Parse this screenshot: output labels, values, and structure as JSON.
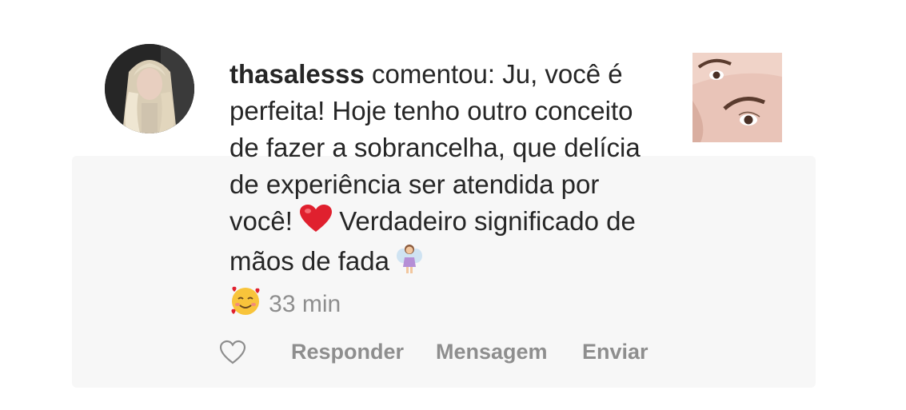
{
  "comment": {
    "username": "thasalesss",
    "text_part1": "comentou: Ju, você é perfeita! Hoje tenho outro conceito de fazer a sobrancelha, que delícia de experiência ser atendida por você! ",
    "text_part2": " Verdadeiro significado de mãos de fada ",
    "timestamp": "33 min"
  },
  "icons": {
    "heart_emoji": "red-heart-emoji",
    "fairy_emoji": "fairy-emoji",
    "smile_emoji": "smiling-face-with-hearts-emoji",
    "like": "heart-outline-icon"
  },
  "actions": {
    "reply_label": "Responder",
    "message_label": "Mensagem",
    "send_label": "Enviar"
  },
  "colors": {
    "text": "#262626",
    "muted": "#8e8e8e",
    "heart": "#e0202e"
  }
}
